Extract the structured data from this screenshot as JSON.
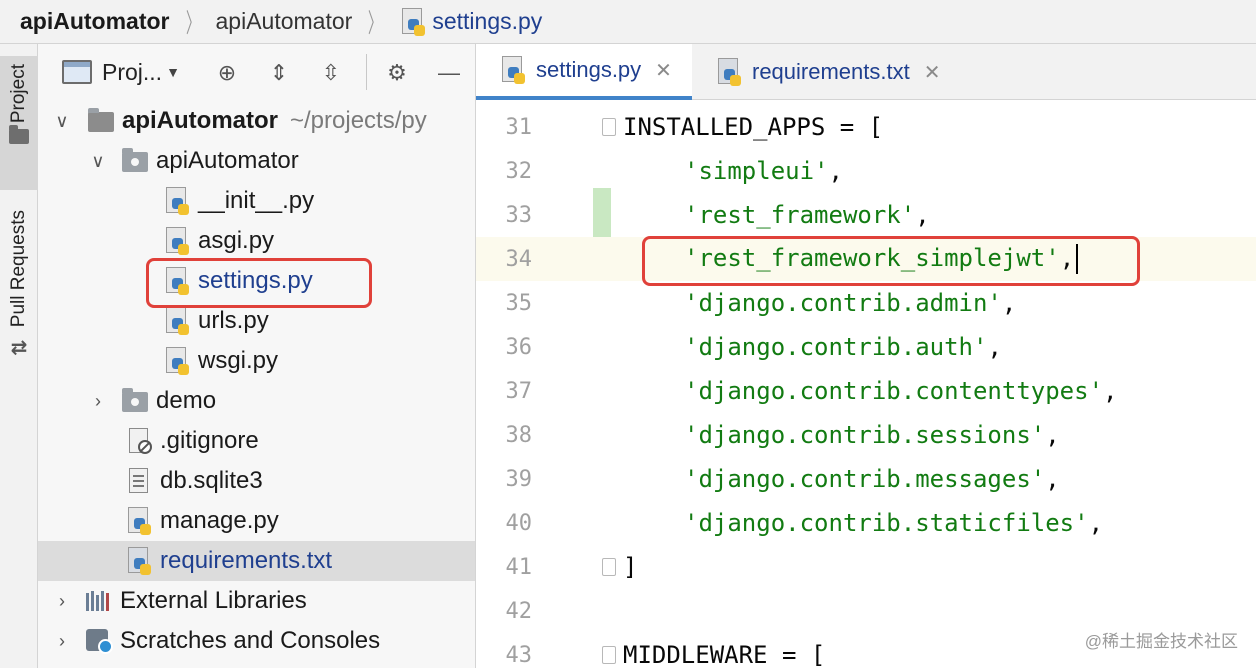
{
  "breadcrumb": {
    "project": "apiAutomator",
    "folder": "apiAutomator",
    "file": "settings.py"
  },
  "toolstrip": {
    "project_tab": "Project",
    "pull_requests_tab": "Pull Requests"
  },
  "project_panel": {
    "title": "Proj...",
    "tree": {
      "root_name": "apiAutomator",
      "root_path": "~/projects/py",
      "package": "apiAutomator",
      "files": [
        "__init__.py",
        "asgi.py",
        "settings.py",
        "urls.py",
        "wsgi.py"
      ],
      "demo": "demo",
      "gitignore": ".gitignore",
      "db": "db.sqlite3",
      "manage": "manage.py",
      "requirements": "requirements.txt",
      "external_libraries": "External Libraries",
      "scratches": "Scratches and Consoles"
    }
  },
  "editor": {
    "tabs": [
      {
        "label": "settings.py",
        "active": true
      },
      {
        "label": "requirements.txt",
        "active": false
      }
    ],
    "line_numbers": [
      "31",
      "32",
      "33",
      "34",
      "35",
      "36",
      "37",
      "38",
      "39",
      "40",
      "41",
      "42",
      "43"
    ],
    "code": {
      "l31": "INSTALLED_APPS = [",
      "l32": "'simpleui'",
      "l33": "'rest_framework'",
      "l34": "'rest_framework_simplejwt'",
      "l35": "'django.contrib.admin'",
      "l36": "'django.contrib.auth'",
      "l37": "'django.contrib.contenttypes'",
      "l38": "'django.contrib.sessions'",
      "l39": "'django.contrib.messages'",
      "l40": "'django.contrib.staticfiles'",
      "l41": "]",
      "l43": "MIDDLEWARE = ["
    },
    "comma": ","
  },
  "watermark": "@稀土掘金技术社区",
  "colors": {
    "string": "#127b12",
    "highlight_box": "#e0413a",
    "link_blue": "#1f3f8f",
    "tab_underline": "#4083c9"
  }
}
